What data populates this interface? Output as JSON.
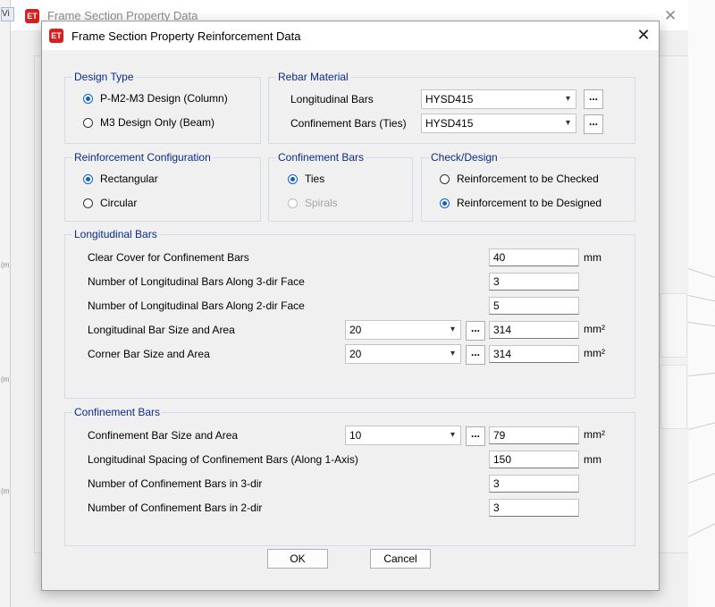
{
  "background_window": {
    "partial_tab_label": "Vi",
    "title": "Frame Section Property Data",
    "close_glyph": "✕",
    "logo_text": "ET",
    "tick_glyph": "(m)"
  },
  "dialog": {
    "logo_text": "ET",
    "title": "Frame Section Property Reinforcement Data",
    "close_glyph": "✕",
    "accent_color": "#0a5fcf",
    "group_title_color": "#0c2a8c"
  },
  "design_type": {
    "title": "Design Type",
    "options": [
      {
        "label": "P-M2-M3 Design  (Column)",
        "checked": true
      },
      {
        "label": "M3 Design Only  (Beam)",
        "checked": false
      }
    ]
  },
  "rebar_material": {
    "title": "Rebar Material",
    "longitudinal_label": "Longitudinal Bars",
    "longitudinal_value": "HYSD415",
    "confinement_label": "Confinement Bars (Ties)",
    "confinement_value": "HYSD415",
    "ellipsis": "..."
  },
  "reinforcement_configuration": {
    "title": "Reinforcement Configuration",
    "options": [
      {
        "label": "Rectangular",
        "checked": true
      },
      {
        "label": "Circular",
        "checked": false
      }
    ]
  },
  "confinement_type": {
    "title": "Confinement Bars",
    "options": [
      {
        "label": "Ties",
        "checked": true,
        "enabled": true
      },
      {
        "label": "Spirals",
        "checked": false,
        "enabled": false
      }
    ]
  },
  "check_design": {
    "title": "Check/Design",
    "options": [
      {
        "label": "Reinforcement to be Checked",
        "checked": false
      },
      {
        "label": "Reinforcement to be Designed",
        "checked": true
      }
    ]
  },
  "longitudinal_bars": {
    "title": "Longitudinal Bars",
    "clear_cover_label": "Clear Cover for Confinement Bars",
    "clear_cover_value": "40",
    "clear_cover_unit": "mm",
    "bars_3dir_label": "Number of Longitudinal Bars Along 3-dir Face",
    "bars_3dir_value": "3",
    "bars_2dir_label": "Number of Longitudinal Bars Along 2-dir Face",
    "bars_2dir_value": "5",
    "bar_size_label": "Longitudinal Bar Size and Area",
    "bar_size_value": "20",
    "bar_area_value": "314",
    "bar_area_unit": "mm²",
    "corner_label": "Corner Bar Size and Area",
    "corner_size_value": "20",
    "corner_area_value": "314",
    "corner_area_unit": "mm²",
    "ellipsis": "..."
  },
  "confinement_bars": {
    "title": "Confinement Bars",
    "size_label": "Confinement Bar Size and Area",
    "size_value": "10",
    "area_value": "79",
    "area_unit": "mm²",
    "spacing_label": "Longitudinal Spacing of Confinement Bars  (Along 1-Axis)",
    "spacing_value": "150",
    "spacing_unit": "mm",
    "num_3dir_label": "Number of Confinement Bars in 3-dir",
    "num_3dir_value": "3",
    "num_2dir_label": "Number of Confinement Bars in 2-dir",
    "num_2dir_value": "3",
    "ellipsis": "..."
  },
  "footer": {
    "ok_label": "OK",
    "cancel_label": "Cancel"
  }
}
